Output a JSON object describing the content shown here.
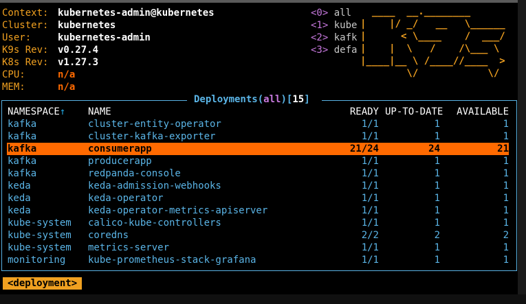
{
  "info": {
    "context_label": "Context:",
    "context_value": "kubernetes-admin@kubernetes",
    "cluster_label": "Cluster:",
    "cluster_value": "kubernetes",
    "user_label": "User:",
    "user_value": "kubernetes-admin",
    "k9s_rev_label": "K9s Rev:",
    "k9s_rev_value": "v0.27.4",
    "k8s_rev_label": "K8s Rev:",
    "k8s_rev_value": "v1.27.3",
    "cpu_label": "CPU:",
    "cpu_value": "n/a",
    "mem_label": "MEM:",
    "mem_value": "n/a"
  },
  "shortcuts": [
    {
      "key": "<0>",
      "label": "all"
    },
    {
      "key": "<1>",
      "label": "kube"
    },
    {
      "key": "<2>",
      "label": "kafk"
    },
    {
      "key": "<3>",
      "label": "defa"
    }
  ],
  "logo": {
    "line1": "  ____  __.________",
    "line2": "|    |/ _/   __   \\______",
    "line3": "|      < \\____    /  ___/",
    "line4": "|    |  \\   /    /\\___ \\",
    "line5": "|____|__ \\ /____//____  >",
    "line6": "        \\/            \\/"
  },
  "view": {
    "resource": "Deployments",
    "open_paren": "(",
    "scope": "all",
    "close_paren": ")",
    "count_open": "[",
    "count": "15",
    "count_close": "]"
  },
  "columns": {
    "namespace": "NAMESPACE",
    "sort_arrow": "↑",
    "name": "NAME",
    "ready": "READY",
    "uptodate": "UP-TO-DATE",
    "available": "AVAILABLE"
  },
  "rows": [
    {
      "namespace": "kafka",
      "name": "cluster-entity-operator",
      "ready": "1/1",
      "uptodate": "1",
      "available": "1"
    },
    {
      "namespace": "kafka",
      "name": "cluster-kafka-exporter",
      "ready": "1/1",
      "uptodate": "1",
      "available": "1"
    },
    {
      "namespace": "kafka",
      "name": "consumerapp",
      "ready": "21/24",
      "uptodate": "24",
      "available": "21"
    },
    {
      "namespace": "kafka",
      "name": "producerapp",
      "ready": "1/1",
      "uptodate": "1",
      "available": "1"
    },
    {
      "namespace": "kafka",
      "name": "redpanda-console",
      "ready": "1/1",
      "uptodate": "1",
      "available": "1"
    },
    {
      "namespace": "keda",
      "name": "keda-admission-webhooks",
      "ready": "1/1",
      "uptodate": "1",
      "available": "1"
    },
    {
      "namespace": "keda",
      "name": "keda-operator",
      "ready": "1/1",
      "uptodate": "1",
      "available": "1"
    },
    {
      "namespace": "keda",
      "name": "keda-operator-metrics-apiserver",
      "ready": "1/1",
      "uptodate": "1",
      "available": "1"
    },
    {
      "namespace": "kube-system",
      "name": "calico-kube-controllers",
      "ready": "1/1",
      "uptodate": "1",
      "available": "1"
    },
    {
      "namespace": "kube-system",
      "name": "coredns",
      "ready": "2/2",
      "uptodate": "2",
      "available": "2"
    },
    {
      "namespace": "kube-system",
      "name": "metrics-server",
      "ready": "1/1",
      "uptodate": "1",
      "available": "1"
    },
    {
      "namespace": "monitoring",
      "name": "kube-prometheus-stack-grafana",
      "ready": "1/1",
      "uptodate": "1",
      "available": "1"
    }
  ],
  "selected_row_index": 2,
  "breadcrumb": "<deployment>",
  "colors": {
    "accent_orange": "#f0a020",
    "selection": "#ff6a00",
    "table_text": "#5ab4e6",
    "shortcut_key": "#c678dd"
  }
}
